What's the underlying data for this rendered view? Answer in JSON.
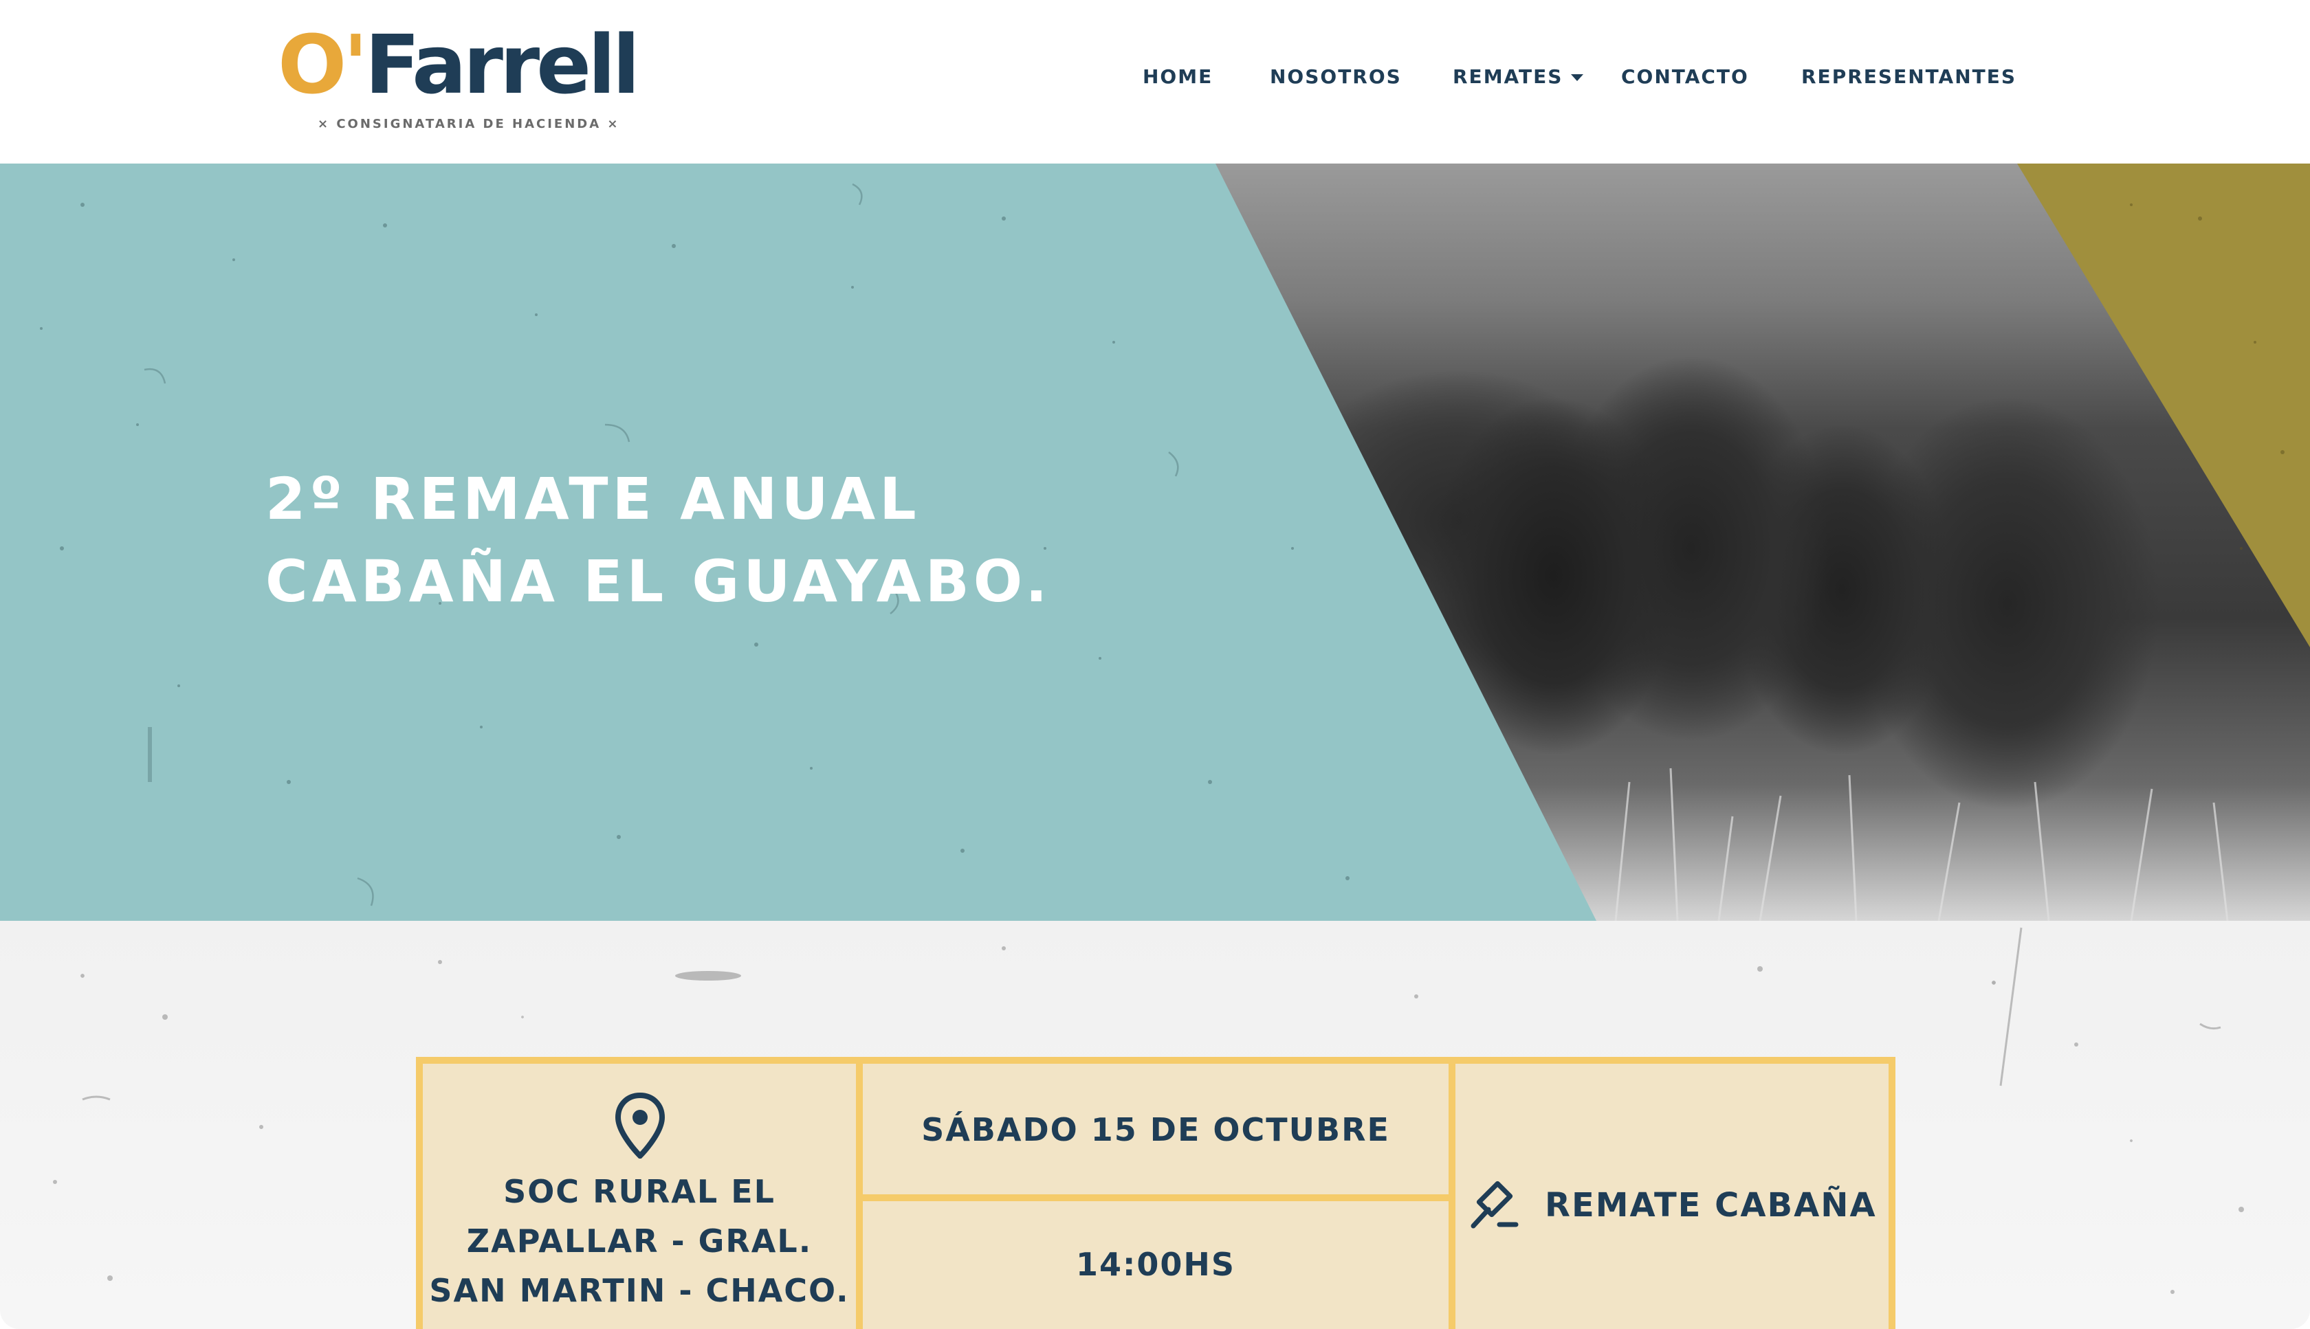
{
  "brand": {
    "logo_o": "O'",
    "logo_rest": "Farrell",
    "tagline": "× CONSIGNATARIA DE HACIENDA ×",
    "colors": {
      "navy": "#1f3d56",
      "gold": "#e8a83a",
      "teal": "#94c5c6",
      "olive": "#a08f3d",
      "cream": "#f2e4c6",
      "border": "#f5cb6a"
    }
  },
  "nav": {
    "home": "HOME",
    "nosotros": "NOSOTROS",
    "remates": "REMATES",
    "contacto": "CONTACTO",
    "representantes": "REPRESENTANTES"
  },
  "hero": {
    "title_line1": "2º REMATE ANUAL",
    "title_line2": "CABAÑA EL GUAYABO."
  },
  "event": {
    "location_line1": "SOC RURAL EL",
    "location_line2": "ZAPALLAR - GRAL.",
    "location_line3": "SAN MARTIN - CHACO.",
    "date": "SÁBADO 15 DE OCTUBRE",
    "time": "14:00HS",
    "type": "REMATE CABAÑA",
    "icons": {
      "location": "map-pin-icon",
      "type": "gavel-icon"
    }
  }
}
